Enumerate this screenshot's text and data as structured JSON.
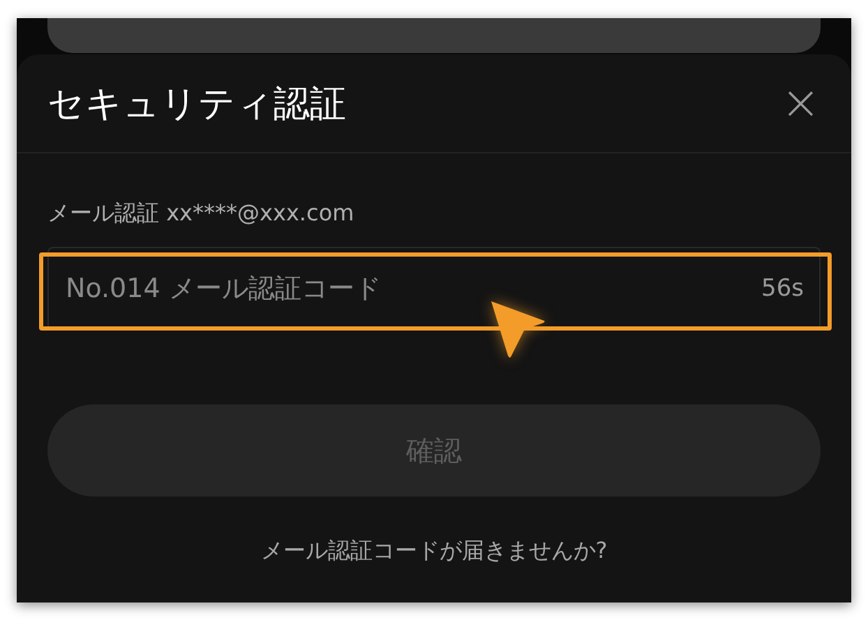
{
  "dialog": {
    "title": "セキュリティ認証",
    "close_icon": "×"
  },
  "email_label": "メール認証 xx****@xxx.com",
  "code_field": {
    "placeholder": "No.014 メール認証コード",
    "countdown": "56s"
  },
  "confirm_button": {
    "label": "確認",
    "disabled": true
  },
  "help_link": "メール認証コードが届きませんか?"
}
